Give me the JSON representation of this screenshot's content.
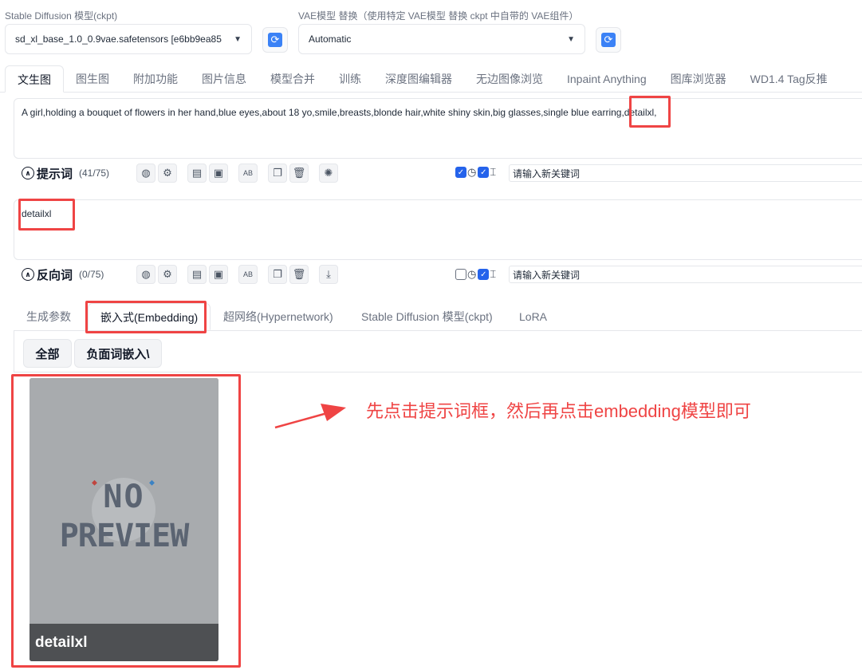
{
  "model": {
    "label": "Stable Diffusion 模型(ckpt)",
    "value": "sd_xl_base_1.0_0.9vae.safetensors [e6bb9ea85"
  },
  "vae": {
    "label": "VAE模型 替换（使用特定 VAE模型 替换 ckpt 中自带的 VAE组件）",
    "value": "Automatic"
  },
  "tabs": [
    "文生图",
    "图生图",
    "附加功能",
    "图片信息",
    "模型合并",
    "训练",
    "深度图编辑器",
    "无边图像浏览",
    "Inpaint Anything",
    "图库浏览器",
    "WD1.4 Tag反推"
  ],
  "prompt": {
    "text_before": "A girl,holding a bouquet of flowers in her hand,blue eyes,about 18 yo,smile,breasts,blonde hair,white shiny skin,big glasses,single blue earring,",
    "text_highlight": "detailxl,",
    "title": "提示词",
    "count": "(41/75)",
    "keyword_placeholder": "请输入新关键词"
  },
  "negative": {
    "text": "detailxl",
    "title": "反向词",
    "count": "(0/75)",
    "keyword_placeholder": "请输入新关键词"
  },
  "subtabs": [
    "生成参数",
    "嵌入式(Embedding)",
    "超网络(Hypernetwork)",
    "Stable Diffusion 模型(ckpt)",
    "LoRA"
  ],
  "filters": [
    "全部",
    "负面词嵌入\\"
  ],
  "card": {
    "placeholder_line1": "NO",
    "placeholder_line2": "PREVIEW",
    "name": "detailxl"
  },
  "annotation": "先点击提示词框，然后再点击embedding模型即可",
  "colors": {
    "accent": "#2563eb",
    "highlight": "#ef4444",
    "card_bg": "#a8abae"
  }
}
